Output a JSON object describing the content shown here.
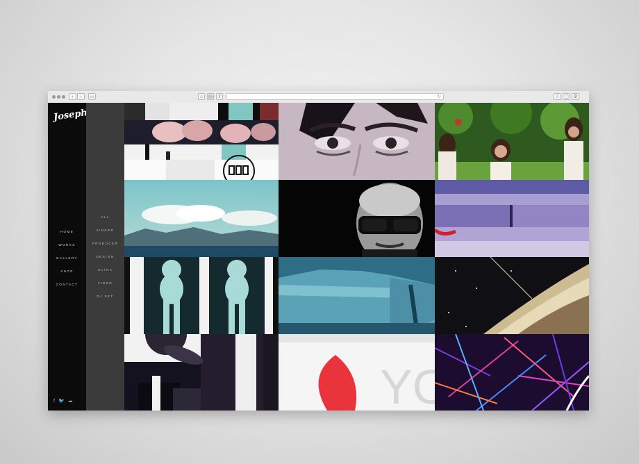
{
  "brand": {
    "logo_text": "Joseph."
  },
  "nav": {
    "items": [
      "HOME",
      "WORKS",
      "GALLERY",
      "SHOP",
      "CONTACT"
    ]
  },
  "filters": {
    "items": [
      "ALL",
      "SINGER",
      "PRODUCER",
      "DESIGN",
      "ULTRA",
      "VIDEO",
      "DJ SET"
    ]
  },
  "social": {
    "icons": [
      "facebook-icon",
      "twitter-icon",
      "soundcloud-icon"
    ],
    "glyphs": [
      "f",
      "🐦",
      "☁"
    ]
  },
  "tiles": [
    {
      "name": "tile-collage-flowers",
      "desc": "collage"
    },
    {
      "name": "tile-woman-eyes",
      "desc": "portrait"
    },
    {
      "name": "tile-women-forest",
      "desc": "forest"
    },
    {
      "name": "tile-clouds-sea",
      "desc": "landscape"
    },
    {
      "name": "tile-man-sunglasses",
      "desc": "portrait"
    },
    {
      "name": "tile-purple-strips",
      "desc": "collage"
    },
    {
      "name": "tile-statue-figures",
      "desc": "art"
    },
    {
      "name": "tile-ice-cliff",
      "desc": "landscape"
    },
    {
      "name": "tile-galaxy",
      "desc": "space"
    },
    {
      "name": "tile-abstract-collage",
      "desc": "collage"
    },
    {
      "name": "tile-typography-red",
      "desc": "typography",
      "text": "YO"
    },
    {
      "name": "tile-neon-grass",
      "desc": "abstract"
    }
  ],
  "colors": {
    "accent_red": "#e8343a",
    "nav_bg": "#0b0b0b",
    "subnav_bg": "#3b3b3b"
  }
}
